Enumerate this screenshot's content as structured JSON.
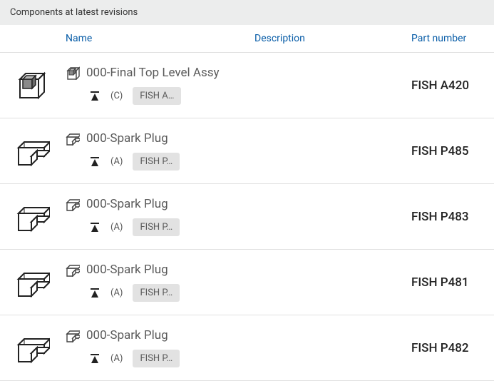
{
  "header": {
    "title": "Components at latest revisions"
  },
  "columns": {
    "name": "Name",
    "description": "Description",
    "part_number": "Part number"
  },
  "rows": [
    {
      "type": "assembly",
      "name": "000-Final Top Level Assy",
      "revision": "(C)",
      "chip": "FISH A…",
      "part_number": "FISH A420"
    },
    {
      "type": "part",
      "name": "000-Spark Plug",
      "revision": "(A)",
      "chip": "FISH P…",
      "part_number": "FISH P485"
    },
    {
      "type": "part",
      "name": "000-Spark Plug",
      "revision": "(A)",
      "chip": "FISH P…",
      "part_number": "FISH P483"
    },
    {
      "type": "part",
      "name": "000-Spark Plug",
      "revision": "(A)",
      "chip": "FISH P…",
      "part_number": "FISH P481"
    },
    {
      "type": "part",
      "name": "000-Spark Plug",
      "revision": "(A)",
      "chip": "FISH P…",
      "part_number": "FISH P482"
    }
  ]
}
